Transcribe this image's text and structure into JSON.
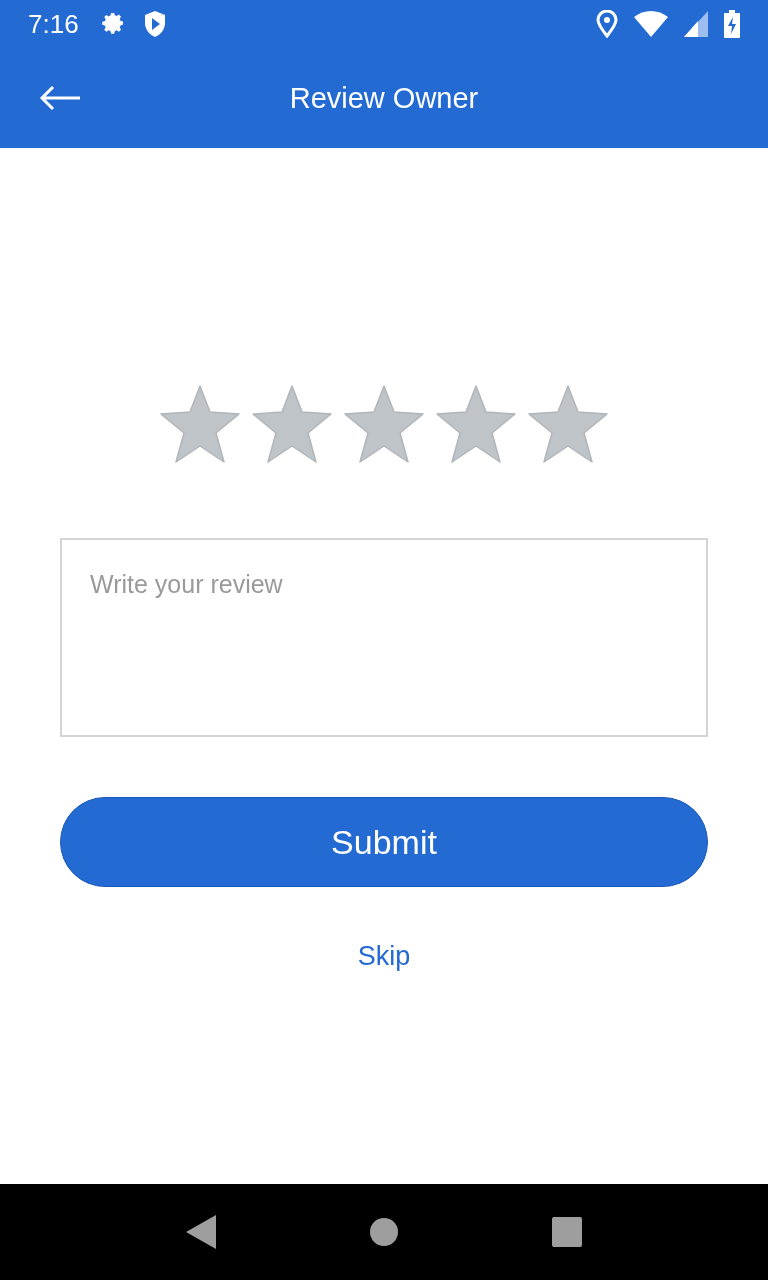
{
  "status_bar": {
    "time": "7:16"
  },
  "app_bar": {
    "title": "Review Owner"
  },
  "rating": {
    "stars": 0
  },
  "review": {
    "placeholder": "Write your review"
  },
  "submit": {
    "label": "Submit"
  },
  "skip": {
    "label": "Skip"
  }
}
